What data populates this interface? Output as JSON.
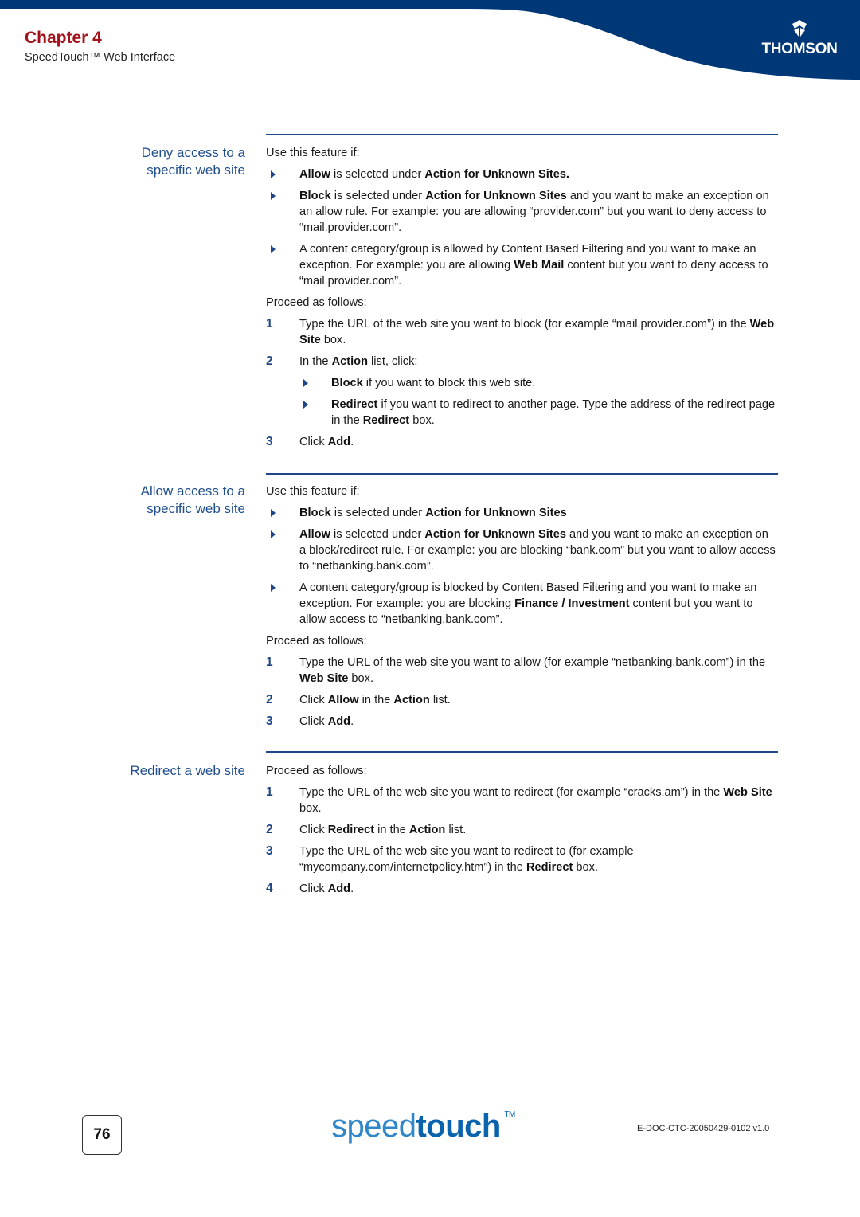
{
  "header": {
    "chapter": "Chapter 4",
    "subtitle": "SpeedTouch™ Web Interface",
    "logo_text": "THOMSON",
    "colors": {
      "banner": "#003777",
      "chapter": "#a3121b",
      "accent": "#1f4788"
    }
  },
  "sections": [
    {
      "title": "Deny access to a\nspecific web site",
      "intro": "Use this feature if:",
      "bullets": [
        [
          {
            "b": "Allow"
          },
          {
            "t": " is selected under "
          },
          {
            "b": "Action for Unknown Sites."
          }
        ],
        [
          {
            "b": "Block"
          },
          {
            "t": " is selected under "
          },
          {
            "b": "Action for Unknown Sites"
          },
          {
            "t": " and you want to make an exception on an allow rule. For example: you are allowing “provider.com” but you want to deny access to “mail.provider.com”."
          }
        ],
        [
          {
            "t": "A content category/group is allowed by Content Based Filtering and you want to make an exception. For example: you are allowing "
          },
          {
            "b": "Web Mail"
          },
          {
            "t": " content but you want to deny access to “mail.provider.com”."
          }
        ]
      ],
      "proceed": "Proceed as follows:",
      "steps": [
        {
          "num": "1",
          "text": [
            {
              "t": "Type the URL of the web site you want to block (for example “mail.provider.com”) in the "
            },
            {
              "b": "Web Site"
            },
            {
              "t": " box."
            }
          ]
        },
        {
          "num": "2",
          "text": [
            {
              "t": "In the "
            },
            {
              "b": "Action"
            },
            {
              "t": " list, click:"
            }
          ],
          "sub": [
            [
              {
                "b": "Block"
              },
              {
                "t": " if you want to block this web site."
              }
            ],
            [
              {
                "b": "Redirect"
              },
              {
                "t": " if you want to redirect to another page. Type the address of the redirect page in the "
              },
              {
                "b": "Redirect"
              },
              {
                "t": " box."
              }
            ]
          ]
        },
        {
          "num": "3",
          "text": [
            {
              "t": "Click "
            },
            {
              "b": "Add"
            },
            {
              "t": "."
            }
          ]
        }
      ]
    },
    {
      "title": "Allow access to a\nspecific web site",
      "intro": "Use this feature if:",
      "bullets": [
        [
          {
            "b": "Block"
          },
          {
            "t": " is selected under "
          },
          {
            "b": "Action for Unknown Sites"
          }
        ],
        [
          {
            "b": "Allow"
          },
          {
            "t": " is selected under "
          },
          {
            "b": "Action for Unknown Sites"
          },
          {
            "t": " and you want to make an exception on a block/redirect rule. For example: you are blocking “bank.com” but you want to allow access to “netbanking.bank.com”."
          }
        ],
        [
          {
            "t": "A content category/group is blocked by Content Based Filtering and you want to make an exception. For example: you are blocking "
          },
          {
            "b": "Finance / Investment"
          },
          {
            "t": " content but you want to allow access to “netbanking.bank.com”."
          }
        ]
      ],
      "proceed": "Proceed as follows:",
      "steps": [
        {
          "num": "1",
          "text": [
            {
              "t": "Type the URL of the web site you want to allow (for example “netbanking.bank.com”) in the "
            },
            {
              "b": "Web Site"
            },
            {
              "t": " box."
            }
          ]
        },
        {
          "num": "2",
          "text": [
            {
              "t": "Click "
            },
            {
              "b": "Allow"
            },
            {
              "t": " in the "
            },
            {
              "b": "Action"
            },
            {
              "t": " list."
            }
          ]
        },
        {
          "num": "3",
          "text": [
            {
              "t": "Click "
            },
            {
              "b": "Add"
            },
            {
              "t": "."
            }
          ]
        }
      ]
    },
    {
      "title": "Redirect a web site",
      "intro": "",
      "bullets": [],
      "proceed": "Proceed as follows:",
      "steps": [
        {
          "num": "1",
          "text": [
            {
              "t": "Type the URL of the web site you want to redirect (for example “cracks.am”) in the "
            },
            {
              "b": "Web Site"
            },
            {
              "t": " box."
            }
          ]
        },
        {
          "num": "2",
          "text": [
            {
              "t": "Click "
            },
            {
              "b": "Redirect"
            },
            {
              "t": " in the "
            },
            {
              "b": "Action"
            },
            {
              "t": " list."
            }
          ]
        },
        {
          "num": "3",
          "text": [
            {
              "t": "Type the URL of the web site you want to redirect to (for example “mycompany.com/internetpolicy.htm”) in the "
            },
            {
              "b": "Redirect"
            },
            {
              "t": " box."
            }
          ]
        },
        {
          "num": "4",
          "text": [
            {
              "t": "Click "
            },
            {
              "b": "Add"
            },
            {
              "t": "."
            }
          ]
        }
      ]
    }
  ],
  "footer": {
    "page_number": "76",
    "brand_light": "speed",
    "brand_bold": "touch",
    "brand_tm": "TM",
    "doc_id": "E-DOC-CTC-20050429-0102 v1.0"
  }
}
